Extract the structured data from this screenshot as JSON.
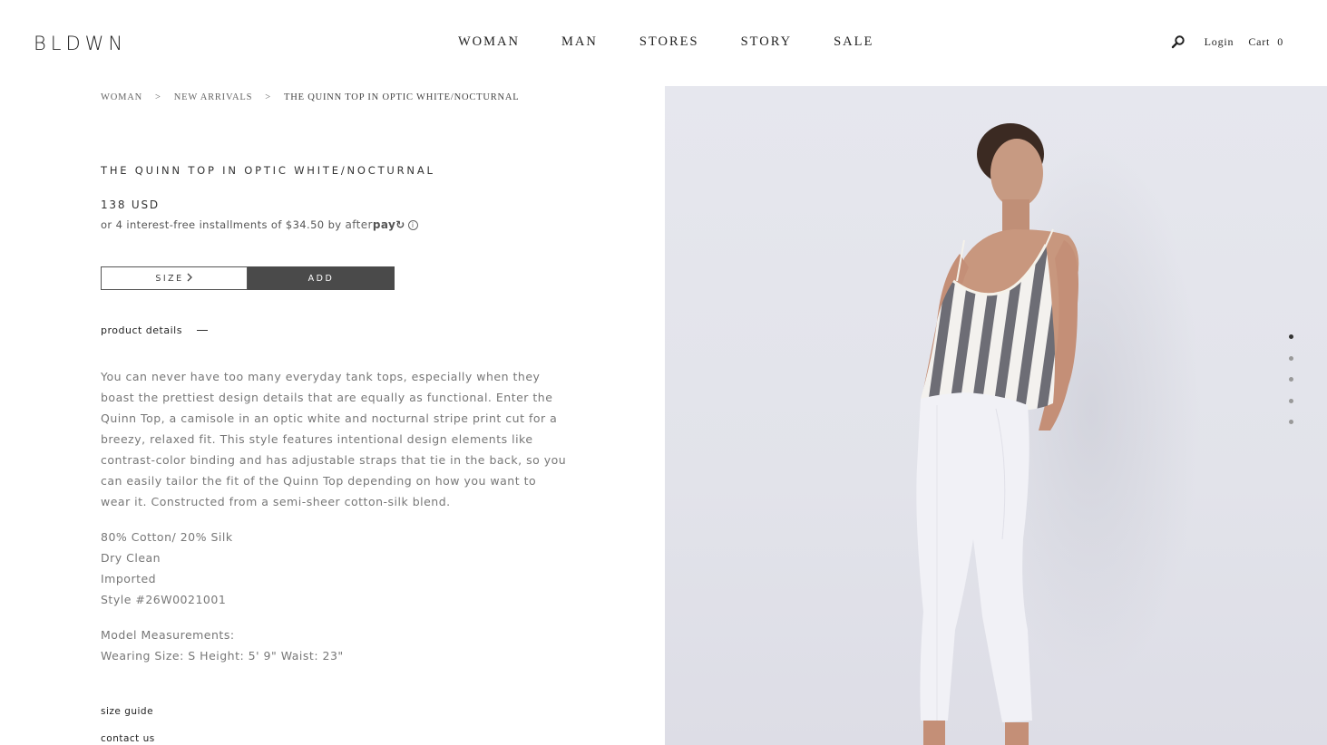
{
  "header": {
    "logo": "BLDWN",
    "nav": [
      "WOMAN",
      "MAN",
      "STORES",
      "STORY",
      "SALE"
    ],
    "login": "Login",
    "cart_label": "Cart",
    "cart_count": "0",
    "icons": {
      "search": "search-icon"
    }
  },
  "breadcrumb": {
    "items": [
      "WOMAN",
      "NEW ARRIVALS",
      "THE QUINN TOP IN OPTIC WHITE/NOCTURNAL"
    ],
    "separator": ">"
  },
  "product": {
    "title": "THE QUINN TOP IN OPTIC WHITE/NOCTURNAL",
    "price": "138 USD",
    "installments": "or 4 interest-free installments of $34.50 by",
    "afterpay_light": "after",
    "afterpay_bold": "pay",
    "afterpay_mark": "↻",
    "info": "i",
    "size_label": "SIZE",
    "add_label": "ADD",
    "details_label": "product details",
    "description": "You can never have too many everyday tank tops, especially when they boast the prettiest design details that are equally as functional. Enter the Quinn Top, a camisole in an optic white and nocturnal stripe print cut for a breezy, relaxed fit. This style features intentional design elements like contrast-color binding and has adjustable straps that tie in the back, so you can easily tailor the fit of the Quinn Top depending on how you want to wear it. Constructed from a semi-sheer cotton-silk blend.",
    "specs": [
      "80% Cotton/ 20% Silk",
      "Dry Clean",
      "Imported",
      "Style #26W0021001"
    ],
    "model_title": "Model Measurements:",
    "model_values": "Wearing Size: S Height: 5' 9\" Waist: 23\"",
    "size_guide": "size guide",
    "contact": "contact us"
  },
  "gallery": {
    "total_images": 5,
    "active_index": 0,
    "colors": {
      "background": "#e3e4eb",
      "stripe_dark": "#6b6b73",
      "jeans": "#f2f2f6"
    }
  }
}
